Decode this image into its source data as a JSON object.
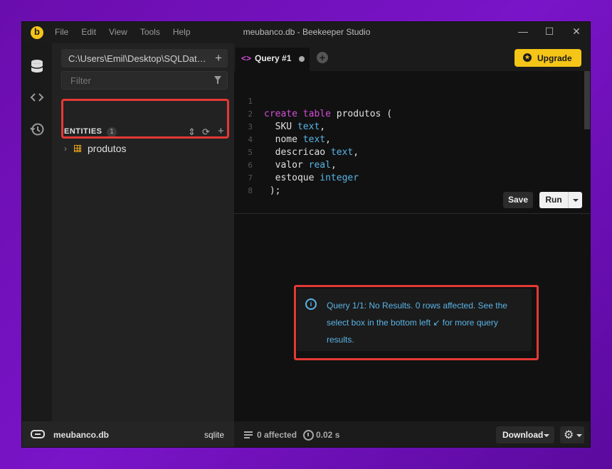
{
  "window": {
    "title": "meubanco.db - Beekeeper Studio",
    "menu": [
      "File",
      "Edit",
      "View",
      "Tools",
      "Help"
    ],
    "controls": {
      "minimize": "—",
      "maximize": "☐",
      "close": "✕"
    }
  },
  "sidebar": {
    "connection_path": "C:\\Users\\Emil\\Desktop\\SQLDatabases\\meubanco.db",
    "filter_placeholder": "Filter",
    "entities_label": "ENTITIES",
    "entities_count": "1",
    "entities": [
      {
        "name": "produtos",
        "type": "table"
      }
    ]
  },
  "tabs": [
    {
      "code_icon": "<>",
      "label": "Query #1",
      "unsaved": true
    }
  ],
  "upgrade": {
    "label": "Upgrade"
  },
  "editor": {
    "lines": [
      {
        "n": "1",
        "text": "create table produtos ("
      },
      {
        "n": "2",
        "text": "  SKU text,"
      },
      {
        "n": "3",
        "text": "  nome text,"
      },
      {
        "n": "4",
        "text": "  descricao text,"
      },
      {
        "n": "5",
        "text": "  valor real,"
      },
      {
        "n": "6",
        "text": "  estoque integer"
      },
      {
        "n": "7",
        "text": " );"
      },
      {
        "n": "8",
        "text": ""
      }
    ],
    "save_label": "Save",
    "run_label": "Run"
  },
  "results": {
    "info_message": "Query 1/1: No Results. 0 rows affected. See the select box in the bottom left ↙ for more query results."
  },
  "status": {
    "db_name": "meubanco.db",
    "db_type": "sqlite",
    "affected": "0 affected",
    "time": "0.02 s",
    "download_label": "Download"
  },
  "colors": {
    "accent": "#f5c518",
    "keyword": "#d24ed6",
    "type": "#5ab4e6",
    "info": "#5ab4e6",
    "highlight": "#e53935"
  }
}
